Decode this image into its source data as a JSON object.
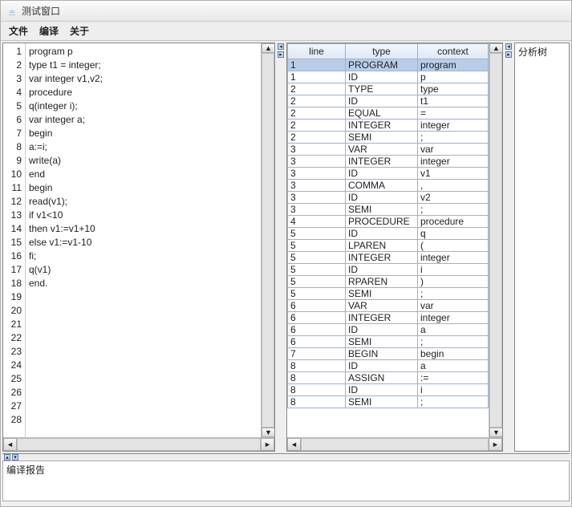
{
  "window": {
    "title": "测试窗口"
  },
  "menu": {
    "file": "文件",
    "compile": "编译",
    "about": "关于"
  },
  "code": {
    "lines": [
      "program p",
      "type t1 = integer;",
      "var integer v1,v2;",
      "procedure",
      "q(integer i);",
      "var integer a;",
      "begin",
      "a:=i;",
      "write(a)",
      "end",
      "begin",
      "read(v1);",
      "if v1<10",
      "then v1:=v1+10",
      "else v1:=v1-10",
      "fi;",
      "q(v1)",
      "end.",
      "",
      "",
      "",
      "",
      "",
      "",
      "",
      "",
      "",
      ""
    ]
  },
  "token_table": {
    "headers": {
      "line": "line",
      "type": "type",
      "context": "context"
    },
    "rows": [
      {
        "line": "1",
        "type": "PROGRAM",
        "context": "program"
      },
      {
        "line": "1",
        "type": "ID",
        "context": "p"
      },
      {
        "line": "2",
        "type": "TYPE",
        "context": "type"
      },
      {
        "line": "2",
        "type": "ID",
        "context": "t1"
      },
      {
        "line": "2",
        "type": "EQUAL",
        "context": "="
      },
      {
        "line": "2",
        "type": "INTEGER",
        "context": "integer"
      },
      {
        "line": "2",
        "type": "SEMI",
        "context": ";"
      },
      {
        "line": "3",
        "type": "VAR",
        "context": "var"
      },
      {
        "line": "3",
        "type": "INTEGER",
        "context": "integer"
      },
      {
        "line": "3",
        "type": "ID",
        "context": "v1"
      },
      {
        "line": "3",
        "type": "COMMA",
        "context": ","
      },
      {
        "line": "3",
        "type": "ID",
        "context": "v2"
      },
      {
        "line": "3",
        "type": "SEMI",
        "context": ";"
      },
      {
        "line": "4",
        "type": "PROCEDURE",
        "context": "procedure"
      },
      {
        "line": "5",
        "type": "ID",
        "context": "q"
      },
      {
        "line": "5",
        "type": "LPAREN",
        "context": "("
      },
      {
        "line": "5",
        "type": "INTEGER",
        "context": "integer"
      },
      {
        "line": "5",
        "type": "ID",
        "context": "i"
      },
      {
        "line": "5",
        "type": "RPAREN",
        "context": ")"
      },
      {
        "line": "5",
        "type": "SEMI",
        "context": ";"
      },
      {
        "line": "6",
        "type": "VAR",
        "context": "var"
      },
      {
        "line": "6",
        "type": "INTEGER",
        "context": "integer"
      },
      {
        "line": "6",
        "type": "ID",
        "context": "a"
      },
      {
        "line": "6",
        "type": "SEMI",
        "context": ";"
      },
      {
        "line": "7",
        "type": "BEGIN",
        "context": "begin"
      },
      {
        "line": "8",
        "type": "ID",
        "context": "a"
      },
      {
        "line": "8",
        "type": "ASSIGN",
        "context": ":="
      },
      {
        "line": "8",
        "type": "ID",
        "context": "i"
      },
      {
        "line": "8",
        "type": "SEMI",
        "context": ";"
      }
    ],
    "selected_row_index": 0
  },
  "tree": {
    "label": "分析树"
  },
  "report": {
    "label": "编译报告"
  }
}
